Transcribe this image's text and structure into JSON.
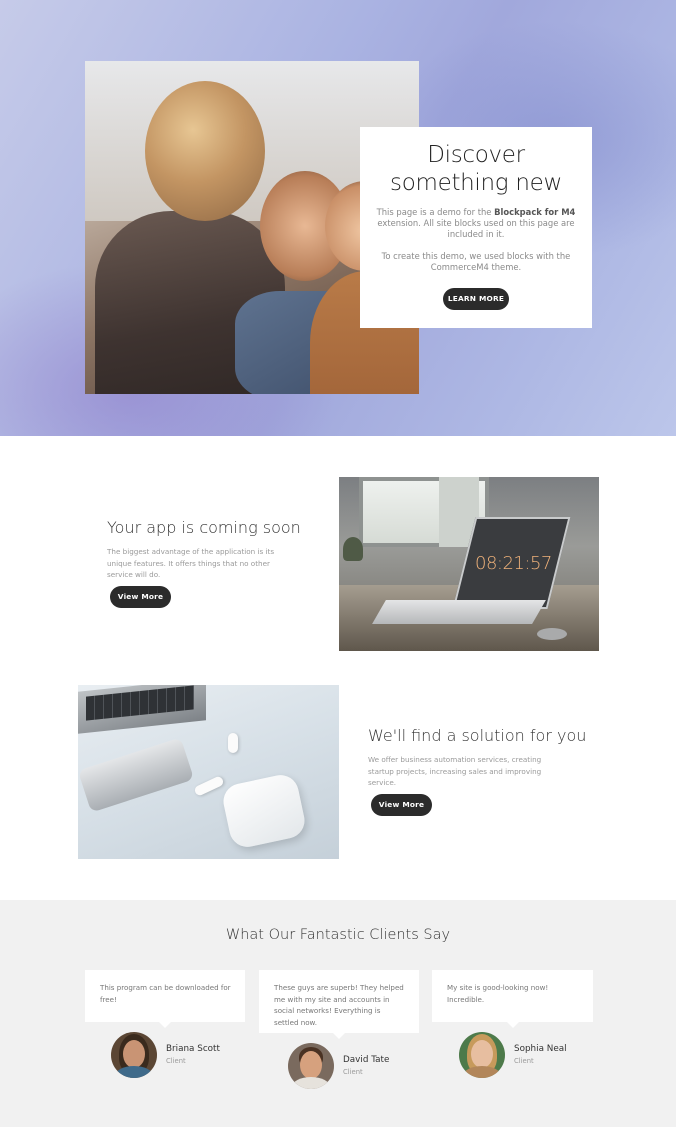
{
  "hero": {
    "title_line1": "Discover",
    "title_line2": "something new",
    "desc_prefix": "This page is a demo for the ",
    "desc_bold": "Blockpack for M4",
    "desc_suffix": " extension. All site blocks used on this page are included in it.",
    "desc2": "To create this demo, we used blocks with the CommerceM4 theme.",
    "button_label": "LEARN MORE"
  },
  "feature1": {
    "title": "Your app is coming soon",
    "text": "The biggest advantage of the application is its unique features. It offers things that no other service will do.",
    "button_label": "View More",
    "clock_text": "08:21:57"
  },
  "feature2": {
    "title": "We'll find a solution for you",
    "text": "We offer business automation services, creating startup projects, increasing sales and improving service.",
    "button_label": "View More"
  },
  "testimonials": {
    "heading": "What Our Fantastic Clients Say",
    "items": [
      {
        "quote": "This program can be downloaded for free!",
        "name": "Briana Scott",
        "role": "Client"
      },
      {
        "quote": "These guys are superb! They helped me with my site and accounts in social networks! Everything is settled now.",
        "name": "David Tate",
        "role": "Client"
      },
      {
        "quote": "My site is good-looking now! Incredible.",
        "name": "Sophia Neal",
        "role": "Client"
      }
    ]
  },
  "colors": {
    "hero_bg": "#a9b2e1",
    "button_dark": "#2b2b2b",
    "testimonials_bg": "#f1f1f1"
  }
}
